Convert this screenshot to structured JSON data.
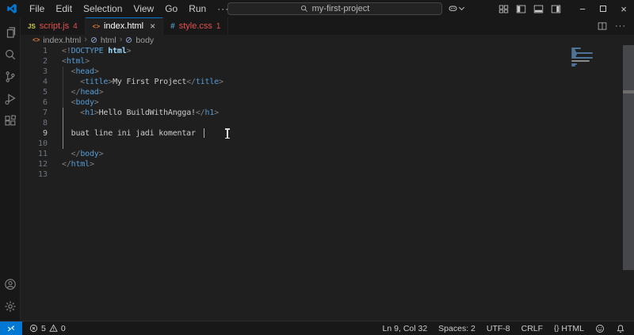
{
  "colors": {
    "accent_blue": "#0078d4",
    "error_red": "#f14c4c",
    "chrome_bg": "#181818",
    "editor_bg": "#1f1f1f",
    "tag_blue": "#569cd6",
    "punct_gray": "#808080",
    "js_icon_yellow": "#cbcb41",
    "css_icon_blue": "#519aba",
    "html_icon_orange": "#e37933"
  },
  "icons": {
    "back": "←",
    "forward": "→",
    "menu_more": "···",
    "tab_more": "···",
    "minimize": "−",
    "close": "×",
    "tab_close": "×",
    "breadcrumb_separator": "›",
    "js_file": "JS",
    "html_file": "<>",
    "css_file": "#",
    "language_braces": "{}"
  },
  "title_bar": {
    "menus": [
      "File",
      "Edit",
      "Selection",
      "View",
      "Go",
      "Run"
    ],
    "search_value": "my-first-project"
  },
  "tab_bar": {
    "tabs": [
      {
        "label": "script.js",
        "badge": "4"
      },
      {
        "label": "index.html"
      },
      {
        "label": "style.css",
        "badge": "1"
      }
    ]
  },
  "breadcrumb": {
    "items": [
      "index.html",
      "html",
      "body"
    ]
  },
  "editor": {
    "cursor_line": 9,
    "lines": [
      {
        "n": "1",
        "tokens": [
          {
            "t": "<!",
            "c": "p"
          },
          {
            "t": "DOCTYPE",
            "c": "k"
          },
          {
            "t": " ",
            "c": "x"
          },
          {
            "t": "html",
            "c": "a"
          },
          {
            "t": ">",
            "c": "p"
          }
        ]
      },
      {
        "n": "2",
        "tokens": [
          {
            "t": "<",
            "c": "p"
          },
          {
            "t": "html",
            "c": "k"
          },
          {
            "t": ">",
            "c": "p"
          }
        ]
      },
      {
        "n": "3",
        "tokens": [
          {
            "t": "  ",
            "c": "x"
          },
          {
            "t": "<",
            "c": "p"
          },
          {
            "t": "head",
            "c": "k"
          },
          {
            "t": ">",
            "c": "p"
          }
        ]
      },
      {
        "n": "4",
        "tokens": [
          {
            "t": "    ",
            "c": "x"
          },
          {
            "t": "<",
            "c": "p"
          },
          {
            "t": "title",
            "c": "k"
          },
          {
            "t": ">",
            "c": "p"
          },
          {
            "t": "My First Project",
            "c": "x"
          },
          {
            "t": "</",
            "c": "p"
          },
          {
            "t": "title",
            "c": "k"
          },
          {
            "t": ">",
            "c": "p"
          }
        ]
      },
      {
        "n": "5",
        "tokens": [
          {
            "t": "  ",
            "c": "x"
          },
          {
            "t": "</",
            "c": "p"
          },
          {
            "t": "head",
            "c": "k"
          },
          {
            "t": ">",
            "c": "p"
          }
        ]
      },
      {
        "n": "6",
        "tokens": [
          {
            "t": "  ",
            "c": "x"
          },
          {
            "t": "<",
            "c": "p"
          },
          {
            "t": "body",
            "c": "k"
          },
          {
            "t": ">",
            "c": "p"
          }
        ]
      },
      {
        "n": "7",
        "tokens": [
          {
            "t": "    ",
            "c": "x"
          },
          {
            "t": "<",
            "c": "p"
          },
          {
            "t": "h1",
            "c": "k"
          },
          {
            "t": ">",
            "c": "p"
          },
          {
            "t": "Hello BuildWithAngga!",
            "c": "x"
          },
          {
            "t": "</",
            "c": "p"
          },
          {
            "t": "h1",
            "c": "k"
          },
          {
            "t": ">",
            "c": "p"
          }
        ]
      },
      {
        "n": "8",
        "tokens": []
      },
      {
        "n": "9",
        "tokens": [
          {
            "t": "  buat line ini jadi komentar",
            "c": "x"
          }
        ],
        "active": true
      },
      {
        "n": "10",
        "tokens": []
      },
      {
        "n": "11",
        "tokens": [
          {
            "t": "  ",
            "c": "x"
          },
          {
            "t": "</",
            "c": "p"
          },
          {
            "t": "body",
            "c": "k"
          },
          {
            "t": ">",
            "c": "p"
          }
        ]
      },
      {
        "n": "12",
        "tokens": [
          {
            "t": "</",
            "c": "p"
          },
          {
            "t": "html",
            "c": "k"
          },
          {
            "t": ">",
            "c": "p"
          }
        ]
      },
      {
        "n": "13",
        "tokens": []
      }
    ]
  },
  "status_bar": {
    "errors": "5",
    "warnings": "0",
    "cursor_position": "Ln 9, Col 32",
    "indentation": "Spaces: 2",
    "encoding": "UTF-8",
    "eol": "CRLF",
    "language": "HTML"
  }
}
